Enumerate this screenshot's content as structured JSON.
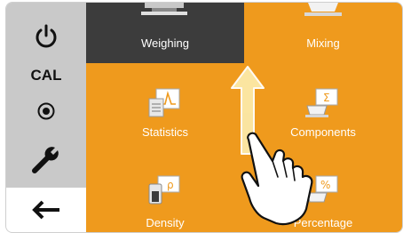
{
  "sidebar": {
    "power_icon": "power-icon",
    "cal_label": "CAL",
    "target_icon": "target-icon",
    "wrench_icon": "wrench-icon",
    "back_icon": "back-arrow-icon"
  },
  "menu": {
    "items": [
      {
        "label": "Weighing",
        "icon": "balance-icon",
        "selected": true
      },
      {
        "label": "Mixing",
        "icon": "mixing-bowl-icon",
        "selected": false
      },
      {
        "label": "Statistics",
        "icon": "statistics-icon",
        "selected": false
      },
      {
        "label": "Components",
        "icon": "components-icon",
        "selected": false
      },
      {
        "label": "Density",
        "icon": "density-icon",
        "selected": false
      },
      {
        "label": "Percentage",
        "icon": "percentage-icon",
        "selected": false
      }
    ]
  },
  "colors": {
    "accent": "#ef9a1d",
    "selected_tile": "#3c3c3c",
    "sidebar": "#c9c9c9"
  },
  "gesture": {
    "type": "swipe-up",
    "hand_icon": "pointing-hand-icon",
    "arrow_icon": "up-arrow-icon"
  }
}
